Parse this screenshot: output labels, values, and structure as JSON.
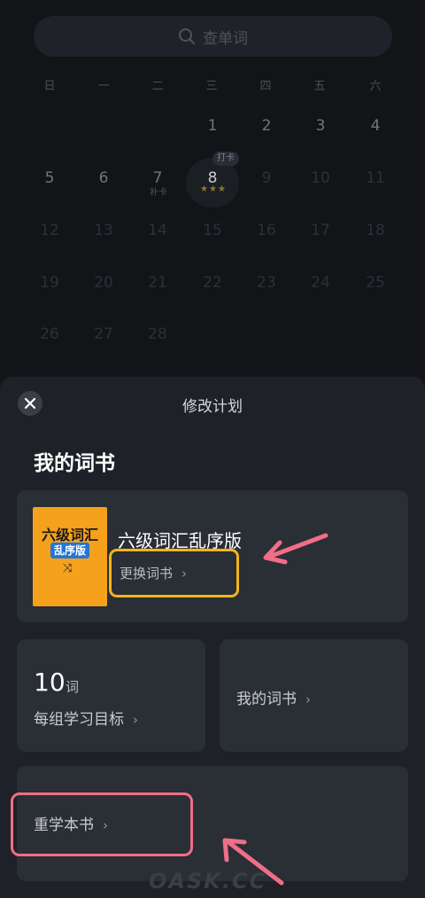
{
  "search": {
    "placeholder": "查单词"
  },
  "weekdays": [
    "日",
    "一",
    "二",
    "三",
    "四",
    "五",
    "六"
  ],
  "calendar": {
    "days": [
      "1",
      "2",
      "3",
      "4",
      "5",
      "6",
      "7",
      "8",
      "9",
      "10",
      "11",
      "12",
      "13",
      "14",
      "15",
      "16",
      "17",
      "18",
      "19",
      "20",
      "21",
      "22",
      "23",
      "24",
      "25",
      "26",
      "27",
      "28"
    ],
    "today": "8",
    "today_tag": "打卡",
    "today_stars": "★★★",
    "makeup_label": "补卡"
  },
  "sheet": {
    "title": "修改计划",
    "section_title": "我的词书",
    "book": {
      "cover_line1": "六级词汇",
      "cover_line2": "乱序版",
      "cover_icon": "⤨",
      "name": "六级词汇乱序版",
      "change_label": "更换词书"
    },
    "goal": {
      "number": "10",
      "unit": "词",
      "label": "每组学习目标"
    },
    "my_books": {
      "label": "我的词书"
    },
    "relearn": {
      "label": "重学本书"
    },
    "chevron": "›"
  },
  "annotations": {
    "highlight_yellow": "#f3b51c",
    "highlight_pink": "#f06e86"
  },
  "watermark": "OASK.CC"
}
